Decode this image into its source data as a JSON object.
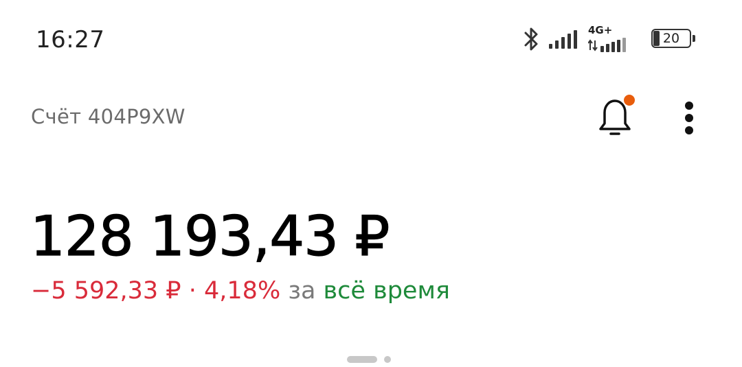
{
  "status_bar": {
    "time": "16:27",
    "network_label": "4G+",
    "battery_level": "20",
    "icons": [
      "bluetooth-icon",
      "signal-icon",
      "signal-4g-icon",
      "battery-icon"
    ]
  },
  "header": {
    "account_label": "Счёт 404P9XW",
    "notification_badge_color": "#e85d0c",
    "icons": [
      "bell-icon",
      "more-vertical-icon"
    ]
  },
  "balance": {
    "amount": "128 193,43 ₽",
    "change_amount": "−5 592,33 ₽",
    "separator": "·",
    "change_percent": "4,18%",
    "period_prefix": "за",
    "period": "всё время"
  },
  "colors": {
    "negative": "#d92b3a",
    "period": "#1e8a3a",
    "muted": "#7a7a7a"
  },
  "pager": {
    "pages": 2,
    "active_index": 0
  }
}
